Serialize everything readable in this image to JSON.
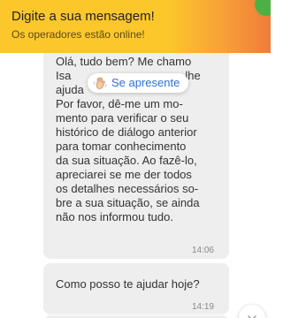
{
  "header": {
    "title": "Digite a sua mensagem!",
    "subtitle": "Os operadores estão online!",
    "gradient_colors": [
      "#fbc72b",
      "#f07b3c"
    ],
    "corner_button_color": "#4cb044"
  },
  "messages": [
    {
      "lines": [
        "Olá, tudo bem? Me chamo",
        "Isa",
        "ajuda",
        "Por favor, dê-me um mo-",
        "mento para verificar o seu",
        "histórico de diálogo anterior",
        "para tomar conhecimento",
        "da sua situação. Ao fazê-lo,",
        "apreciarei se me der todos",
        "os detalhes necessários so-",
        "bre a sua situação, se ainda",
        "não nos informou tudo."
      ],
      "visible_fragment": "lhe",
      "time": "14:06"
    },
    {
      "lines": [
        "Como posso te ajudar hoje?"
      ],
      "time": "14:19"
    }
  ],
  "introduce_prompt": {
    "label": "Se apresente",
    "icon": "waving-hand-icon"
  },
  "scroll_button": {
    "icon": "chevron-down-icon"
  },
  "colors": {
    "bubble_background": "#eeeeee",
    "link_blue": "#2d6fd6"
  }
}
